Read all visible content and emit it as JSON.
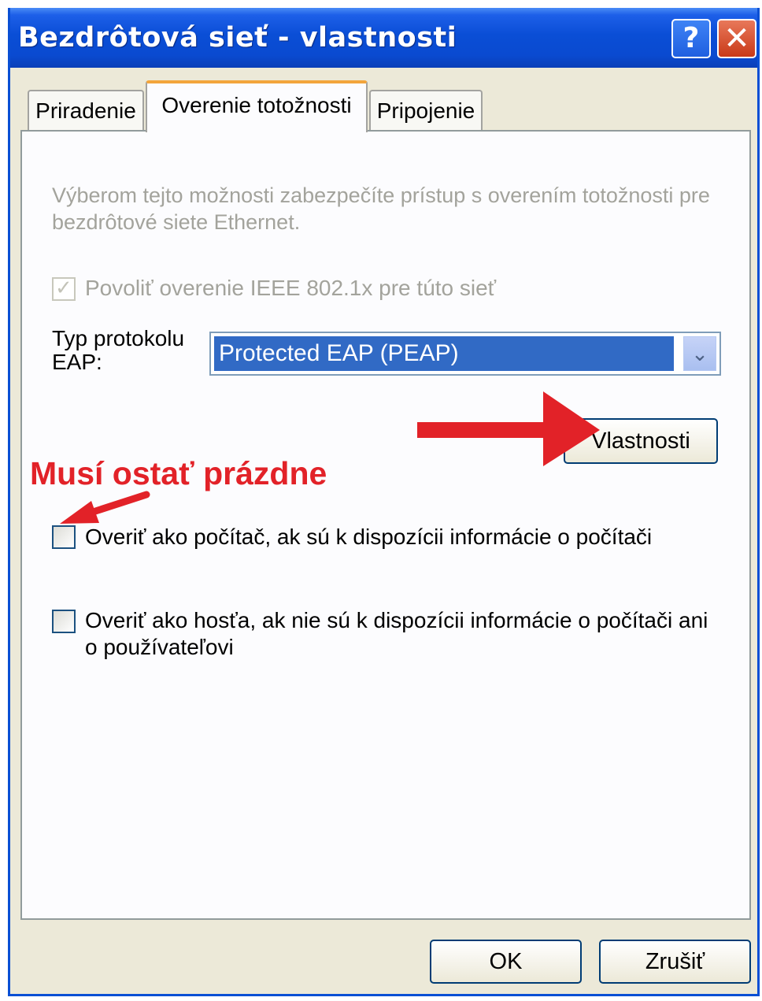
{
  "window": {
    "title": "Bezdrôtová sieť - vlastnosti",
    "help_label": "?",
    "close_label": "✕"
  },
  "tabs": [
    {
      "label": "Priradenie",
      "active": false
    },
    {
      "label": "Overenie totožnosti",
      "active": true
    },
    {
      "label": "Pripojenie",
      "active": false
    }
  ],
  "panel": {
    "description": "Výberom tejto možnosti zabezpečíte prístup s overením totožnosti pre bezdrôtové siete Ethernet.",
    "enable_8021x": {
      "label": "Povoliť overenie IEEE 802.1x pre túto sieť",
      "checked": true,
      "disabled": true
    },
    "eap_type": {
      "label_line1": "Typ protokolu",
      "label_line2": "EAP:",
      "value": "Protected EAP (PEAP)"
    },
    "properties_button": "Vlastnosti",
    "auth_as_computer": {
      "label": "Overiť ako počítač, ak sú k dispozícii informácie o počítači",
      "checked": false
    },
    "auth_as_guest": {
      "label_line1": "Overiť ako hosťa, ak nie sú k dispozícii informácie o počítači ani",
      "label_line2": "o používateľovi",
      "checked": false
    }
  },
  "annotation": {
    "text": "Musí ostať prázdne",
    "color": "#e22228"
  },
  "footer": {
    "ok_label": "OK",
    "cancel_label": "Zrušiť"
  },
  "colors": {
    "titlebar": "#0a4ed6",
    "tab_highlight": "#f3a53c",
    "selection": "#316ac5",
    "annotation": "#e22228"
  }
}
